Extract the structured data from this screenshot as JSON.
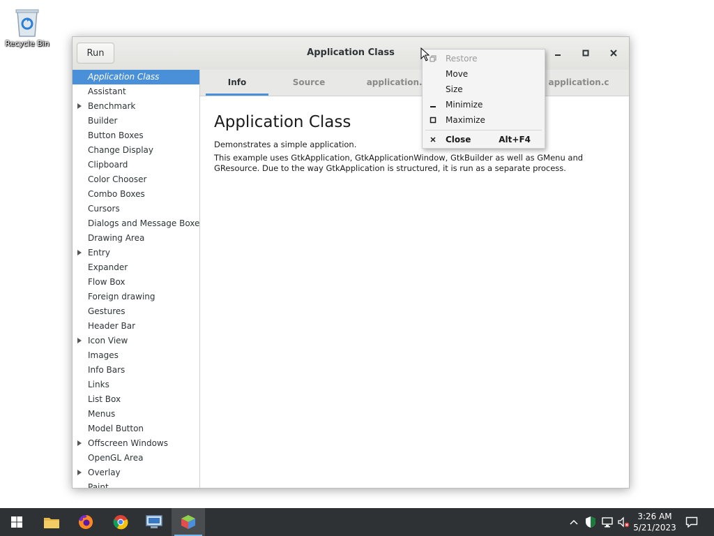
{
  "desktop": {
    "recycle_bin_label": "Recycle Bin"
  },
  "window": {
    "title": "Application Class",
    "run_label": "Run"
  },
  "sidebar": {
    "items": [
      {
        "label": "Application Class",
        "selected": true,
        "expandable": false
      },
      {
        "label": "Assistant",
        "selected": false,
        "expandable": false
      },
      {
        "label": "Benchmark",
        "selected": false,
        "expandable": true
      },
      {
        "label": "Builder",
        "selected": false,
        "expandable": false
      },
      {
        "label": "Button Boxes",
        "selected": false,
        "expandable": false
      },
      {
        "label": "Change Display",
        "selected": false,
        "expandable": false
      },
      {
        "label": "Clipboard",
        "selected": false,
        "expandable": false
      },
      {
        "label": "Color Chooser",
        "selected": false,
        "expandable": false
      },
      {
        "label": "Combo Boxes",
        "selected": false,
        "expandable": false
      },
      {
        "label": "Cursors",
        "selected": false,
        "expandable": false
      },
      {
        "label": "Dialogs and Message Boxes",
        "selected": false,
        "expandable": false
      },
      {
        "label": "Drawing Area",
        "selected": false,
        "expandable": false
      },
      {
        "label": "Entry",
        "selected": false,
        "expandable": true
      },
      {
        "label": "Expander",
        "selected": false,
        "expandable": false
      },
      {
        "label": "Flow Box",
        "selected": false,
        "expandable": false
      },
      {
        "label": "Foreign drawing",
        "selected": false,
        "expandable": false
      },
      {
        "label": "Gestures",
        "selected": false,
        "expandable": false
      },
      {
        "label": "Header Bar",
        "selected": false,
        "expandable": false
      },
      {
        "label": "Icon View",
        "selected": false,
        "expandable": true
      },
      {
        "label": "Images",
        "selected": false,
        "expandable": false
      },
      {
        "label": "Info Bars",
        "selected": false,
        "expandable": false
      },
      {
        "label": "Links",
        "selected": false,
        "expandable": false
      },
      {
        "label": "List Box",
        "selected": false,
        "expandable": false
      },
      {
        "label": "Menus",
        "selected": false,
        "expandable": false
      },
      {
        "label": "Model Button",
        "selected": false,
        "expandable": false
      },
      {
        "label": "Offscreen Windows",
        "selected": false,
        "expandable": true
      },
      {
        "label": "OpenGL Area",
        "selected": false,
        "expandable": false
      },
      {
        "label": "Overlay",
        "selected": false,
        "expandable": true
      },
      {
        "label": "Paint",
        "selected": false,
        "expandable": false
      }
    ]
  },
  "tabs": [
    {
      "label": "Info",
      "active": true
    },
    {
      "label": "Source",
      "active": false
    },
    {
      "label": "application.ui",
      "active": false
    },
    {
      "label": "application.c",
      "active": false
    }
  ],
  "content": {
    "heading": "Application Class",
    "paragraph1": "Demonstrates a simple application.",
    "paragraph2": "This example uses GtkApplication, GtkApplicationWindow, GtkBuilder as well as GMenu and GResource. Due to the way GtkApplication is structured, it is run as a separate process."
  },
  "context_menu": {
    "restore": "Restore",
    "move": "Move",
    "size": "Size",
    "minimize": "Minimize",
    "maximize": "Maximize",
    "close": "Close",
    "close_shortcut": "Alt+F4"
  },
  "taskbar": {
    "apps": [
      "start-icon",
      "file-explorer-icon",
      "firefox-icon",
      "chrome-icon",
      "remote-desktop-icon",
      "gtk-demo-icon"
    ],
    "clock_time": "3:26 AM",
    "clock_date": "5/21/2023"
  },
  "colors": {
    "selection": "#4a90d9",
    "taskbar": "#2f3234"
  }
}
